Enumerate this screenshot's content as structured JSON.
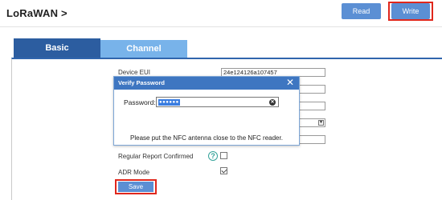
{
  "header": {
    "title": "LoRaWAN >",
    "read_label": "Read",
    "write_label": "Write"
  },
  "tabs": [
    {
      "label": "Basic",
      "active": true
    },
    {
      "label": "Channel",
      "active": false
    }
  ],
  "form": {
    "device_eui_label": "Device EUI",
    "device_eui_value": "24e124126a107457",
    "regular_report_label": "Regular Report Confirmed",
    "regular_report_checked": false,
    "adr_mode_label": "ADR Mode",
    "adr_mode_checked": true,
    "help_glyph": "?",
    "save_label": "Save"
  },
  "dialog": {
    "title": "Verify Password",
    "close_glyph": "✕",
    "password_label": "Password:",
    "password_value": "●●●●●●",
    "message": "Please put the NFC antenna close to the NFC reader."
  },
  "colors": {
    "accent": "#5b8fd4",
    "tab_active": "#2c5da0",
    "tab_inactive": "#78b3ea",
    "highlight_frame": "#e0271c",
    "dialog_title": "#3e76c1"
  }
}
